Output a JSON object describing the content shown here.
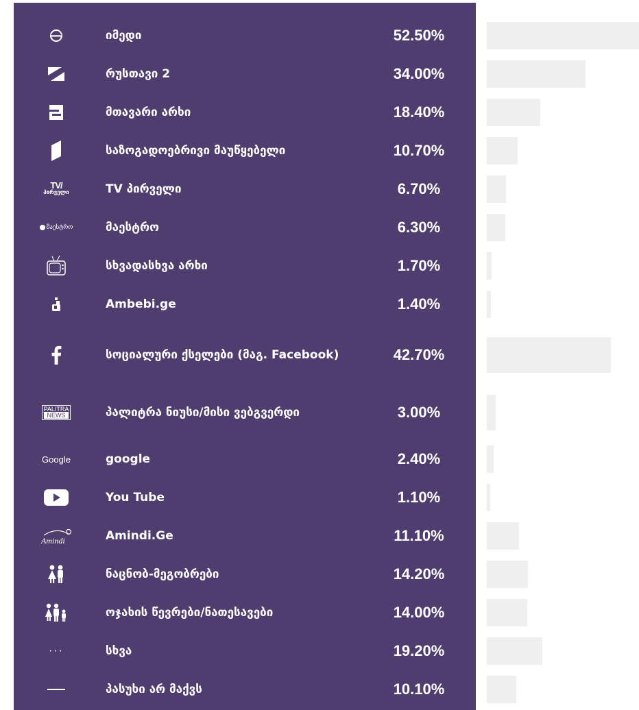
{
  "chart_data": {
    "type": "bar",
    "orientation": "horizontal",
    "unit": "%",
    "max_value": 52.5,
    "categories": [
      "იმედი",
      "რუსთავი 2",
      "მთავარი არხი",
      "საზოგადოებრივი მაუწყებელი",
      "TV პირველი",
      "მაესტრო",
      "სხვადასხვა არხი",
      "Ambebi.ge",
      "სოციალური ქსელები (მაგ. Facebook)",
      "პალიტრა ნიუსი/მისი ვებგვერდი",
      "google",
      "You Tube",
      "Amindi.Ge",
      "ნაცნობ-მეგობრები",
      "ოჯახის წევრები/ნათესავები",
      "სხვა",
      "პასუხი არ მაქვს"
    ],
    "values": [
      52.5,
      34.0,
      18.4,
      10.7,
      6.7,
      6.3,
      1.7,
      1.4,
      42.7,
      3.0,
      2.4,
      1.1,
      11.1,
      14.2,
      14.0,
      19.2,
      10.1
    ],
    "value_labels": [
      "52.50%",
      "34.00%",
      "18.40%",
      "10.70%",
      "6.70%",
      "6.30%",
      "1.70%",
      "1.40%",
      "42.70%",
      "3.00%",
      "2.40%",
      "1.10%",
      "11.10%",
      "14.20%",
      "14.00%",
      "19.20%",
      "10.10%"
    ],
    "icons": [
      "imedi-logo-icon",
      "rustavi2-logo-icon",
      "mtavari-logo-icon",
      "public-broadcaster-logo-icon",
      "tv-pirveli-logo-icon",
      "maestro-logo-icon",
      "tv-set-icon",
      "ambebi-logo-icon",
      "facebook-icon",
      "palitra-news-logo-icon",
      "google-logo-icon",
      "youtube-icon",
      "amindi-logo-icon",
      "friends-icon",
      "family-icon",
      "ellipsis-icon",
      "dash-icon"
    ],
    "icon_texts": {
      "tv_pirveli_top": "TV/",
      "tv_pirveli_bottom": "პირველი",
      "maestro": "მაესტრო",
      "palitra_top": "PALITRA",
      "palitra_bottom": "NEWS",
      "google": "Google",
      "amindi": "Amindi",
      "ellipsis": "···"
    },
    "colors": {
      "panel": "#4f3d6f",
      "bar": "#efefef",
      "text": "#ffffff"
    }
  }
}
